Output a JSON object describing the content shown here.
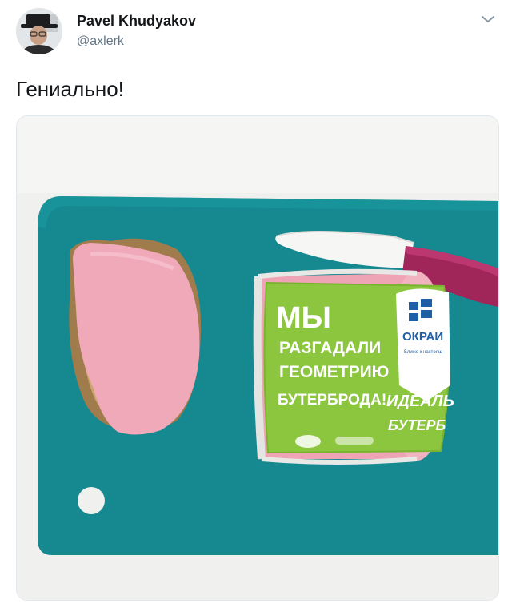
{
  "tweet": {
    "author_name": "Pavel Khudyakov",
    "author_handle": "@axlerk",
    "text": "Гениально!",
    "icons": {
      "avatar": "avatar-photo",
      "menu": "chevron-down-icon"
    }
  },
  "photo": {
    "label_lines": [
      "МЫ",
      "РАЗГАДАЛИ",
      "ГЕОМЕТРИЮ",
      "БУТЕРБРОДА!"
    ],
    "label_side_lines": [
      "ИДЕАЛЬ",
      "БУТЕРБ"
    ],
    "brand": "ОКРАИ",
    "brand_tagline": "Ближе к настоящ",
    "colors": {
      "board": "#15898f",
      "label_green": "#8cc63f",
      "sausage": "#f0a9b8"
    }
  }
}
